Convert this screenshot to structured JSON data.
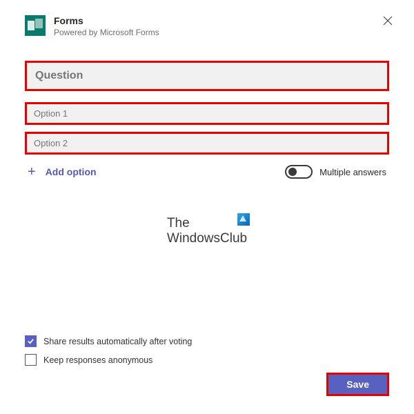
{
  "header": {
    "title": "Forms",
    "subtitle": "Powered by Microsoft Forms"
  },
  "form": {
    "question_placeholder": "Question",
    "options": [
      {
        "placeholder": "Option 1"
      },
      {
        "placeholder": "Option 2"
      }
    ],
    "add_option_label": "Add option",
    "multiple_answers_label": "Multiple answers"
  },
  "watermark": {
    "line1": "The",
    "line2": "WindowsClub"
  },
  "footer": {
    "share_results_label": "Share results automatically after voting",
    "share_results_checked": true,
    "keep_anonymous_label": "Keep responses anonymous",
    "keep_anonymous_checked": false,
    "save_label": "Save"
  },
  "colors": {
    "highlight_border": "#e60000",
    "accent": "#5860c0",
    "teal": "#0a7b6a"
  }
}
